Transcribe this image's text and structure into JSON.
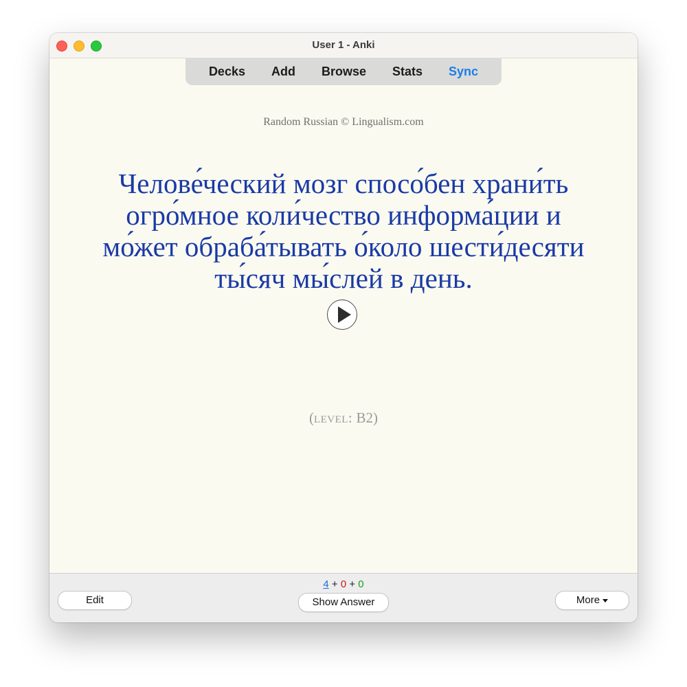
{
  "window": {
    "title": "User 1 - Anki"
  },
  "toolbar": {
    "items": [
      "Decks",
      "Add",
      "Browse",
      "Stats",
      "Sync"
    ],
    "sync_color": "#1a7ee8"
  },
  "card": {
    "credit": "Random Russian © Lingualism.com",
    "sentence_lines": [
      "Челове́ческий мозг спосо́бен храни́ть",
      "огро́мное коли́чество информа́ции и",
      "мо́жет обраба́тывать о́коло шести́десяти",
      "ты́сяч мы́слей в день."
    ],
    "sentence_color": "#1a3aa6",
    "play_icon": "play-icon",
    "level_open": "(",
    "level_label": "level:",
    "level_value": " B2)"
  },
  "bottombar": {
    "counts": {
      "new": "4",
      "learn": "0",
      "review": "0",
      "sep": " + "
    },
    "edit_label": "Edit",
    "show_answer_label": "Show Answer",
    "more_label": "More"
  }
}
